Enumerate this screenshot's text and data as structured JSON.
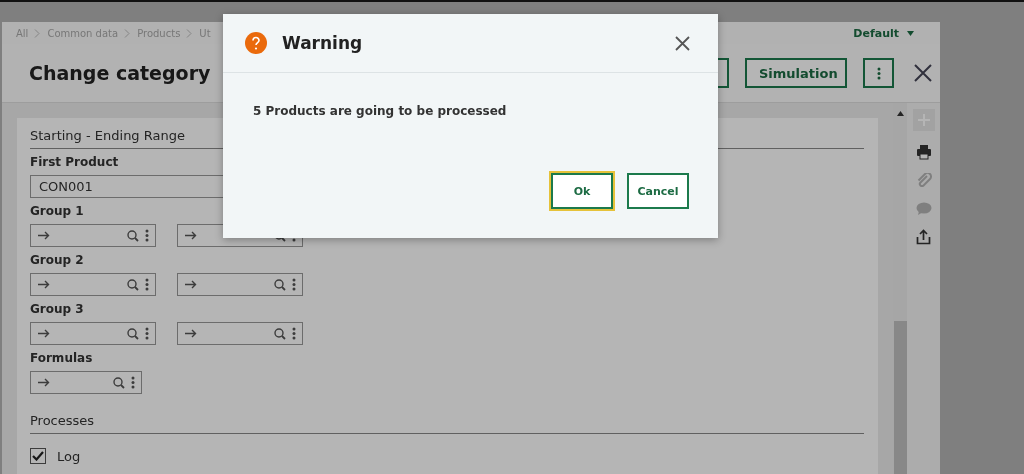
{
  "breadcrumb": [
    "All",
    "Common data",
    "Products",
    "Ut"
  ],
  "view_selector": {
    "label": "Default"
  },
  "header": {
    "title": "Change category",
    "buttons": [
      "Simulation"
    ]
  },
  "sections": [
    {
      "title": "Starting - Ending Range",
      "fields": [
        {
          "kind": "text",
          "label": "First Product",
          "value": "CON001"
        },
        {
          "kind": "range",
          "label": "Group 1"
        },
        {
          "kind": "range",
          "label": "Group 2"
        },
        {
          "kind": "range",
          "label": "Group 3"
        },
        {
          "kind": "lookup",
          "label": "Formulas"
        }
      ]
    },
    {
      "title": "Processes",
      "checkboxes": [
        {
          "label": "Log",
          "checked": true
        }
      ]
    }
  ],
  "side_toolbar": [
    {
      "kind": "add",
      "disabled": true
    },
    {
      "kind": "print",
      "disabled": false
    },
    {
      "kind": "attach",
      "disabled": true
    },
    {
      "kind": "comment",
      "disabled": true
    },
    {
      "kind": "share",
      "disabled": false
    }
  ],
  "dialog": {
    "title": "Warning",
    "message": "5 Products are going to be processed",
    "buttons": [
      {
        "label": "Ok",
        "focused": true
      },
      {
        "label": "Cancel",
        "focused": false
      }
    ]
  }
}
